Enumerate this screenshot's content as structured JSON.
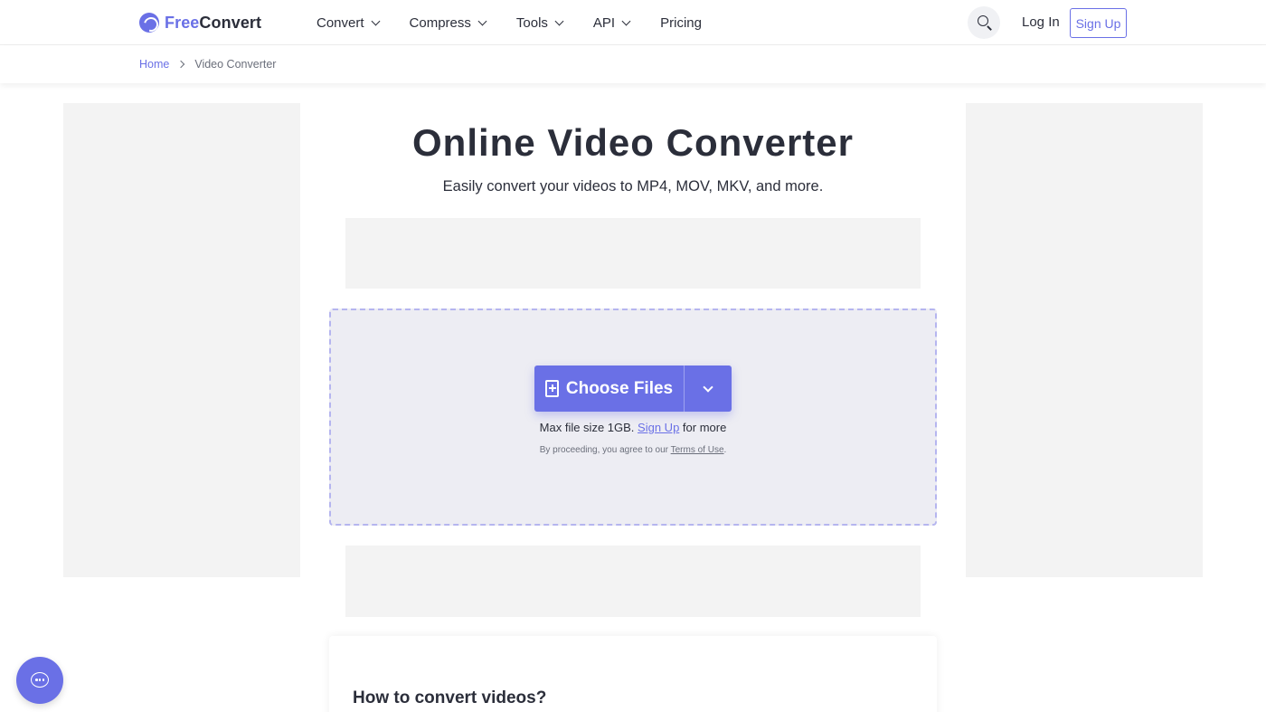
{
  "header": {
    "logo_free": "Free",
    "logo_convert": "Convert",
    "nav": [
      {
        "label": "Convert",
        "has_dropdown": true
      },
      {
        "label": "Compress",
        "has_dropdown": true
      },
      {
        "label": "Tools",
        "has_dropdown": true
      },
      {
        "label": "API",
        "has_dropdown": true
      },
      {
        "label": "Pricing",
        "has_dropdown": false
      }
    ],
    "search_icon": "search-icon",
    "login_label": "Log In",
    "signup_label": "Sign Up"
  },
  "breadcrumb": {
    "home": "Home",
    "current": "Video Converter"
  },
  "main": {
    "title": "Online Video Converter",
    "subtitle": "Easily convert your videos to MP4, MOV, MKV, and more."
  },
  "upload": {
    "choose_label": "Choose Files",
    "max_prefix": "Max file size 1GB.",
    "max_link": "Sign Up",
    "max_suffix": "for more",
    "terms_prefix": "By proceeding, you agree to our",
    "terms_link": "Terms of Use",
    "terms_suffix": "."
  },
  "howto": {
    "title": "How to convert videos?"
  },
  "colors": {
    "accent": "#6a70e6",
    "text": "#2b2e3a",
    "dropzone_bg": "#ededf3",
    "ad_bg": "#f3f3f3"
  }
}
